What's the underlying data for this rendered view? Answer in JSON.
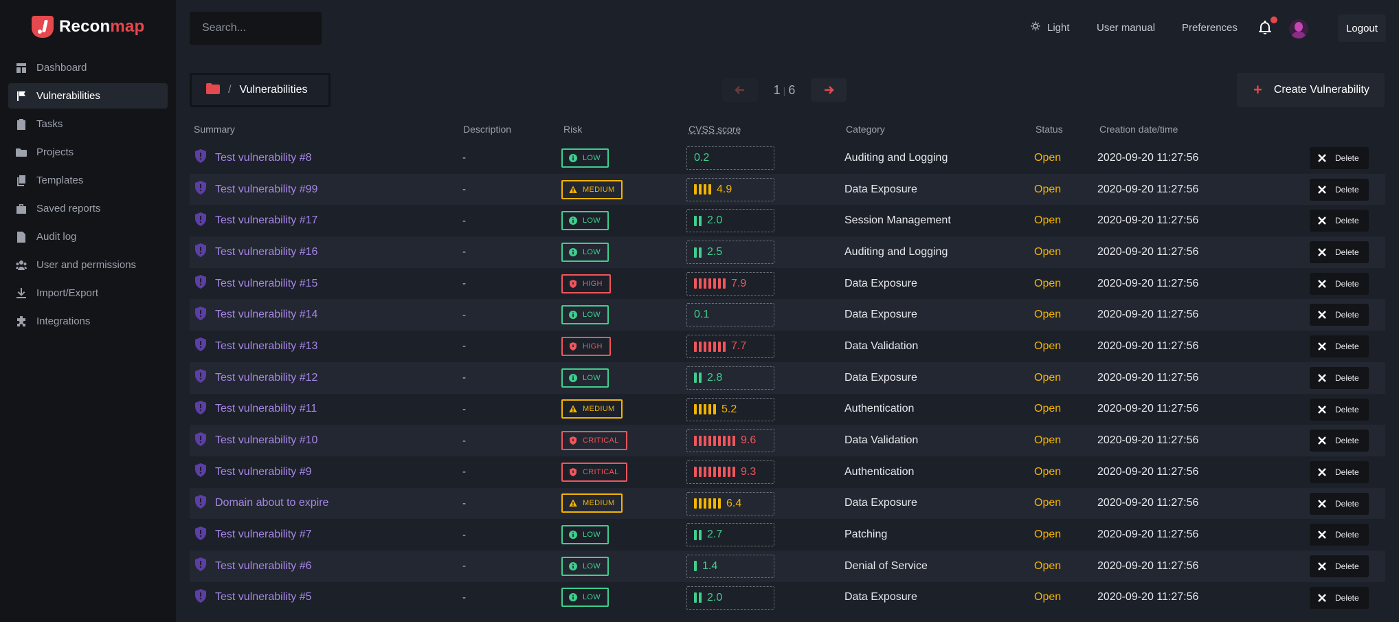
{
  "app": {
    "name_main": "Recon",
    "name_accent": "map"
  },
  "sidebar": {
    "items": [
      {
        "label": "Dashboard",
        "icon": "dashboard-icon",
        "active": false
      },
      {
        "label": "Vulnerabilities",
        "icon": "flag-icon",
        "active": true
      },
      {
        "label": "Tasks",
        "icon": "clipboard-icon",
        "active": false
      },
      {
        "label": "Projects",
        "icon": "folder-icon",
        "active": false
      },
      {
        "label": "Templates",
        "icon": "copy-icon",
        "active": false
      },
      {
        "label": "Saved reports",
        "icon": "briefcase-icon",
        "active": false
      },
      {
        "label": "Audit log",
        "icon": "document-icon",
        "active": false
      },
      {
        "label": "User and permissions",
        "icon": "users-icon",
        "active": false
      },
      {
        "label": "Import/Export",
        "icon": "download-icon",
        "active": false
      },
      {
        "label": "Integrations",
        "icon": "puzzle-icon",
        "active": false
      }
    ]
  },
  "header": {
    "search_placeholder": "Search...",
    "theme_label": "Light",
    "manual_label": "User manual",
    "preferences_label": "Preferences",
    "logout_label": "Logout"
  },
  "toolbar": {
    "breadcrumb_sep": "/",
    "breadcrumb_current": "Vulnerabilities",
    "page_current": "1",
    "page_total": "6",
    "create_label": "Create Vulnerability"
  },
  "table": {
    "columns": [
      "Summary",
      "Description",
      "Risk",
      "CVSS score",
      "Category",
      "Status",
      "Creation date/time"
    ],
    "delete_label": "Delete",
    "rows": [
      {
        "summary": "Test vulnerability #8",
        "description": "-",
        "risk": "LOW",
        "cvss": "0.2",
        "category": "Auditing and Logging",
        "status": "Open",
        "created": "2020-09-20 11:27:56"
      },
      {
        "summary": "Test vulnerability #99",
        "description": "-",
        "risk": "MEDIUM",
        "cvss": "4.9",
        "category": "Data Exposure",
        "status": "Open",
        "created": "2020-09-20 11:27:56"
      },
      {
        "summary": "Test vulnerability #17",
        "description": "-",
        "risk": "LOW",
        "cvss": "2.0",
        "category": "Session Management",
        "status": "Open",
        "created": "2020-09-20 11:27:56"
      },
      {
        "summary": "Test vulnerability #16",
        "description": "-",
        "risk": "LOW",
        "cvss": "2.5",
        "category": "Auditing and Logging",
        "status": "Open",
        "created": "2020-09-20 11:27:56"
      },
      {
        "summary": "Test vulnerability #15",
        "description": "-",
        "risk": "HIGH",
        "cvss": "7.9",
        "category": "Data Exposure",
        "status": "Open",
        "created": "2020-09-20 11:27:56"
      },
      {
        "summary": "Test vulnerability #14",
        "description": "-",
        "risk": "LOW",
        "cvss": "0.1",
        "category": "Data Exposure",
        "status": "Open",
        "created": "2020-09-20 11:27:56"
      },
      {
        "summary": "Test vulnerability #13",
        "description": "-",
        "risk": "HIGH",
        "cvss": "7.7",
        "category": "Data Validation",
        "status": "Open",
        "created": "2020-09-20 11:27:56"
      },
      {
        "summary": "Test vulnerability #12",
        "description": "-",
        "risk": "LOW",
        "cvss": "2.8",
        "category": "Data Exposure",
        "status": "Open",
        "created": "2020-09-20 11:27:56"
      },
      {
        "summary": "Test vulnerability #11",
        "description": "-",
        "risk": "MEDIUM",
        "cvss": "5.2",
        "category": "Authentication",
        "status": "Open",
        "created": "2020-09-20 11:27:56"
      },
      {
        "summary": "Test vulnerability #10",
        "description": "-",
        "risk": "CRITICAL",
        "cvss": "9.6",
        "category": "Data Validation",
        "status": "Open",
        "created": "2020-09-20 11:27:56"
      },
      {
        "summary": "Test vulnerability #9",
        "description": "-",
        "risk": "CRITICAL",
        "cvss": "9.3",
        "category": "Authentication",
        "status": "Open",
        "created": "2020-09-20 11:27:56"
      },
      {
        "summary": "Domain about to expire",
        "description": "-",
        "risk": "MEDIUM",
        "cvss": "6.4",
        "category": "Data Exposure",
        "status": "Open",
        "created": "2020-09-20 11:27:56"
      },
      {
        "summary": "Test vulnerability #7",
        "description": "-",
        "risk": "LOW",
        "cvss": "2.7",
        "category": "Patching",
        "status": "Open",
        "created": "2020-09-20 11:27:56"
      },
      {
        "summary": "Test vulnerability #6",
        "description": "-",
        "risk": "LOW",
        "cvss": "1.4",
        "category": "Denial of Service",
        "status": "Open",
        "created": "2020-09-20 11:27:56"
      },
      {
        "summary": "Test vulnerability #5",
        "description": "-",
        "risk": "LOW",
        "cvss": "2.0",
        "category": "Data Exposure",
        "status": "Open",
        "created": "2020-09-20 11:27:56"
      }
    ]
  },
  "colors": {
    "accent": "#e5484d",
    "low": "#3ecf8e",
    "medium": "#f4b400",
    "high": "#f2555a",
    "link": "#a586e6"
  }
}
